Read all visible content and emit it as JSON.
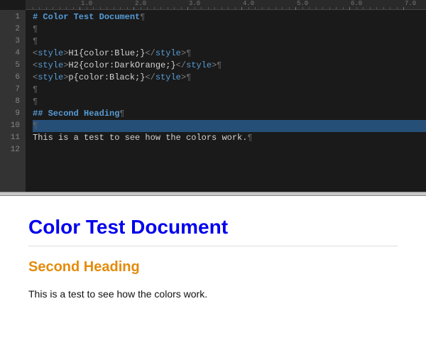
{
  "editor": {
    "ruler": [
      "1.0",
      "2.0",
      "3.0",
      "4.0",
      "5.0",
      "6.0",
      "7.0"
    ],
    "lineNumbers": [
      "1",
      "2",
      "3",
      "4",
      "5",
      "6",
      "7",
      "8",
      "9",
      "10",
      "11",
      "12"
    ],
    "lines": {
      "l1": {
        "text": "# Color Test Document",
        "pilcrow": "¶"
      },
      "l2": {
        "pilcrow": "¶"
      },
      "l3": {
        "pilcrow": "¶"
      },
      "l4": {
        "open": "<",
        "tag": "style",
        "close": ">",
        "sel": "H1",
        "rule": "{color:Blue;}",
        "copen": "</",
        "ctag": "style",
        "cclose": ">",
        "pilcrow": "¶"
      },
      "l5": {
        "open": "<",
        "tag": "style",
        "close": ">",
        "sel": "H2",
        "rule": "{color:DarkOrange;}",
        "copen": "</",
        "ctag": "style",
        "cclose": ">",
        "pilcrow": "¶"
      },
      "l6": {
        "open": "<",
        "tag": "style",
        "close": ">",
        "sel": "p",
        "rule": "{color:Black;}",
        "copen": "</",
        "ctag": "style",
        "cclose": ">",
        "pilcrow": "¶"
      },
      "l7": {
        "pilcrow": "¶"
      },
      "l8": {
        "pilcrow": "¶"
      },
      "l9": {
        "text": "## Second Heading",
        "pilcrow": "¶"
      },
      "l10": {
        "pilcrow": "¶"
      },
      "l11": {
        "text": "This is a test to see how the colors work.",
        "pilcrow": "¶"
      },
      "l12": {
        "text": ""
      }
    }
  },
  "preview": {
    "h1": "Color Test Document",
    "h2": "Second Heading",
    "p": "This is a test to see how the colors work.",
    "colors": {
      "h1": "#0000ee",
      "h2": "#e48b0a",
      "p": "#111111"
    }
  }
}
